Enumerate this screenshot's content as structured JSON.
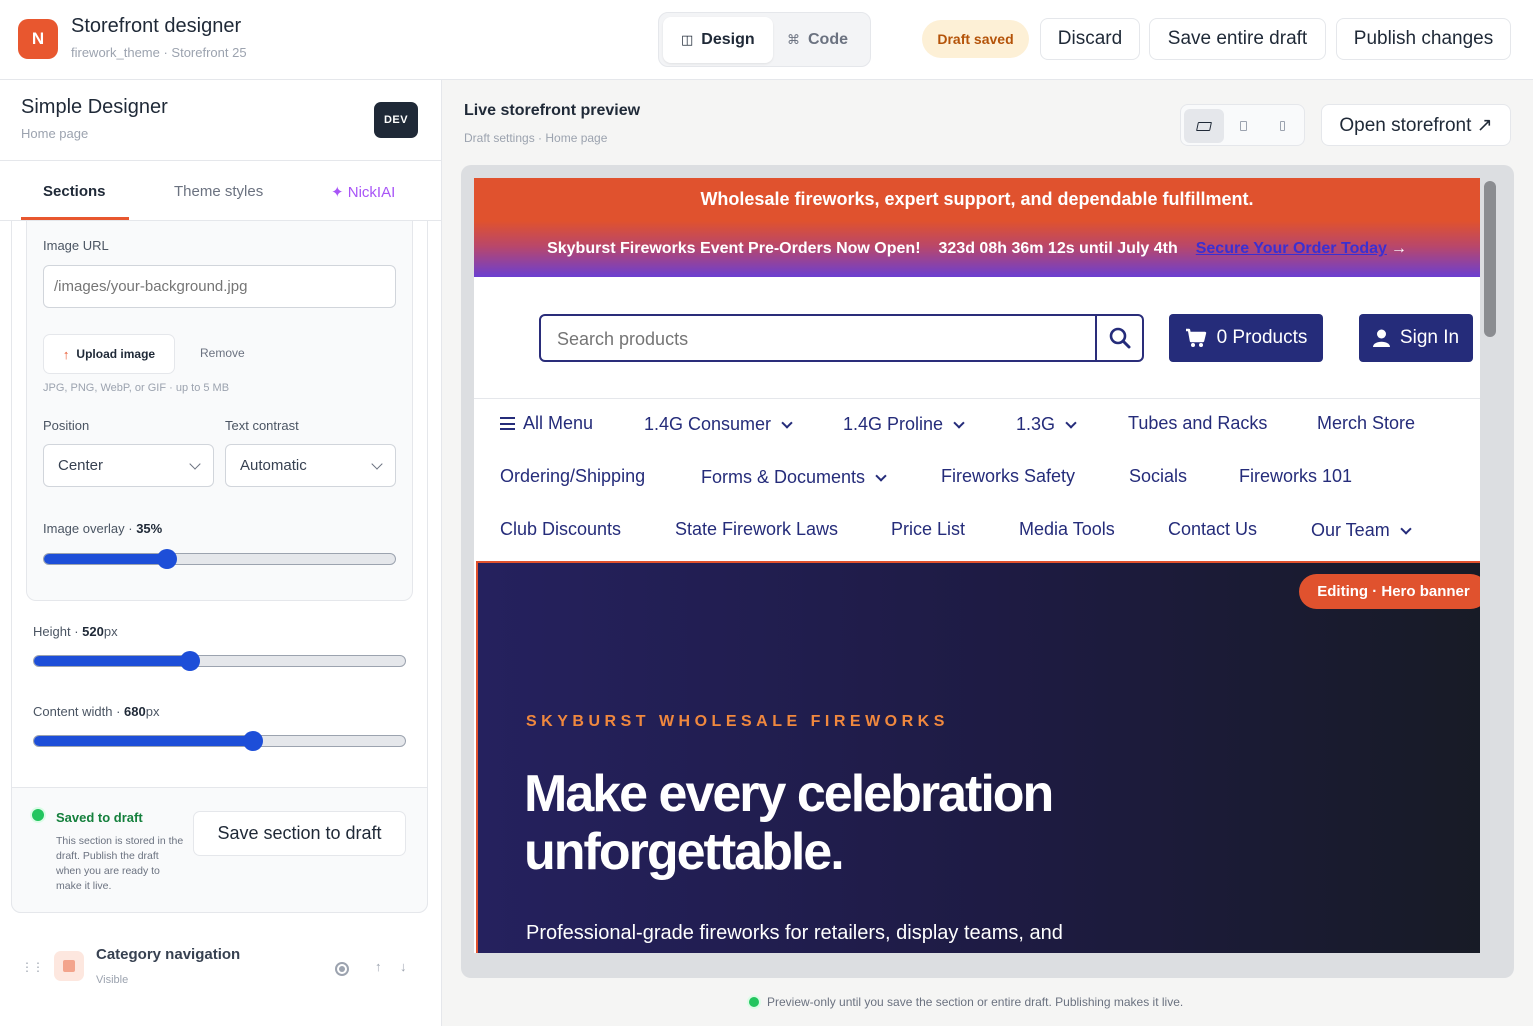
{
  "app": {
    "logo_letter": "N",
    "title": "Storefront designer",
    "subtitle": "firework_theme · Storefront 25"
  },
  "mode_toggle": {
    "design": {
      "label": "Design",
      "icon": "layout-icon",
      "glyph": "◫"
    },
    "code": {
      "label": "Code",
      "icon": "command-icon",
      "glyph": "⌘"
    }
  },
  "toolbar": {
    "draft_status": "Draft saved",
    "discard_label": "Discard",
    "save_draft_label": "Save entire draft",
    "publish_label": "Publish changes"
  },
  "sidebar": {
    "title": "Simple Designer",
    "subtitle": "Home page",
    "env_badge": "DEV",
    "tabs": [
      {
        "label": "Sections"
      },
      {
        "label": "Theme styles"
      },
      {
        "label": "✦ NickIAI"
      }
    ],
    "image_url": {
      "label": "Image URL",
      "placeholder": "/images/your-background.jpg"
    },
    "upload": {
      "label": "Upload image",
      "remove_label": "Remove",
      "hint": "JPG, PNG, WebP, or GIF · up to 5 MB"
    },
    "position": {
      "label": "Position",
      "value": "Center"
    },
    "text_contrast": {
      "label": "Text contrast",
      "value": "Automatic"
    },
    "overlay": {
      "label": "Image overlay · ",
      "value_text": "35%",
      "value": 0.35
    },
    "height": {
      "label": "Height · ",
      "value_text": "520",
      "unit": "px",
      "fraction": 0.42
    },
    "content_width": {
      "label": "Content width · ",
      "value_text": "680",
      "unit": "px",
      "fraction": 0.59
    },
    "save_status": {
      "label": "Saved to draft",
      "note": "This section is stored in the draft. Publish the draft when you are ready to make it live.",
      "button": "Save section to draft"
    },
    "next_section": {
      "title": "Category navigation",
      "status": "Visible"
    }
  },
  "preview": {
    "title": "Live storefront preview",
    "subtitle": "Draft settings · Home page",
    "open_label": "Open storefront ↗",
    "footer_note": "Preview-only until you save the section or entire draft. Publishing makes it live."
  },
  "storefront": {
    "announcement": "Wholesale fireworks, expert support, and dependable fulfillment.",
    "promo": {
      "text": "Skyburst Fireworks Event Pre-Orders Now Open!",
      "countdown": "323d 08h 36m 12s until July 4th",
      "cta": "Secure Your Order Today",
      "cta_arrow": "→"
    },
    "search_placeholder": "Search products",
    "cart_label": "0 Products",
    "signin_label": "Sign In",
    "nav": [
      {
        "label": "All Menu"
      },
      {
        "label": "1.4G Consumer"
      },
      {
        "label": "1.4G Proline"
      },
      {
        "label": "1.3G"
      },
      {
        "label": "Tubes and Racks"
      },
      {
        "label": "Merch Store"
      },
      {
        "label": "Ordering/Shipping"
      },
      {
        "label": "Forms & Documents"
      },
      {
        "label": "Fireworks Safety"
      },
      {
        "label": "Socials"
      },
      {
        "label": "Fireworks 101"
      },
      {
        "label": "Club Discounts"
      },
      {
        "label": "State Firework Laws"
      },
      {
        "label": "Price List"
      },
      {
        "label": "Media Tools"
      },
      {
        "label": "Contact Us"
      },
      {
        "label": "Our Team"
      }
    ],
    "hero": {
      "editing_badge": "Editing · Hero banner",
      "eyebrow": "SKYBURST WHOLESALE FIREWORKS",
      "heading": "Make every celebration unforgettable.",
      "body": "Professional-grade fireworks for retailers, display teams, and"
    }
  },
  "colors": {
    "accent": "#e8572f",
    "navy": "#252c7a",
    "slider": "#1d4ed8",
    "success": "#22c55e"
  }
}
